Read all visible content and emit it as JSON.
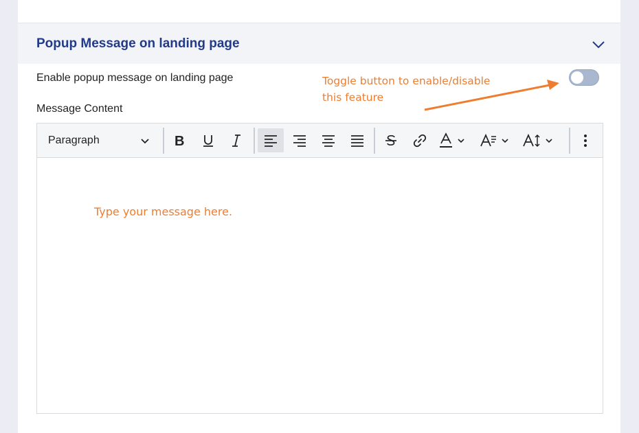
{
  "section": {
    "title": "Popup Message on landing page"
  },
  "enable": {
    "label": "Enable popup message on landing page",
    "toggle_on": false
  },
  "annotation": {
    "line1": "Toggle button to enable/disable",
    "line2": "this feature",
    "color": "#ee7d2f"
  },
  "editor": {
    "label": "Message Content",
    "block_format": "Paragraph",
    "placeholder": "Type your message here.",
    "toolbar_icons": [
      "bold-icon",
      "underline-icon",
      "italic-icon",
      "align-left-icon",
      "align-right-icon",
      "align-center-icon",
      "align-justify-icon",
      "strikethrough-icon",
      "link-icon",
      "text-color-icon",
      "font-style-icon",
      "font-size-icon",
      "more-icon"
    ]
  },
  "colors": {
    "title": "#213a8a",
    "toggle_off": "#aab8cf",
    "header_bg": "#f3f4f8"
  }
}
